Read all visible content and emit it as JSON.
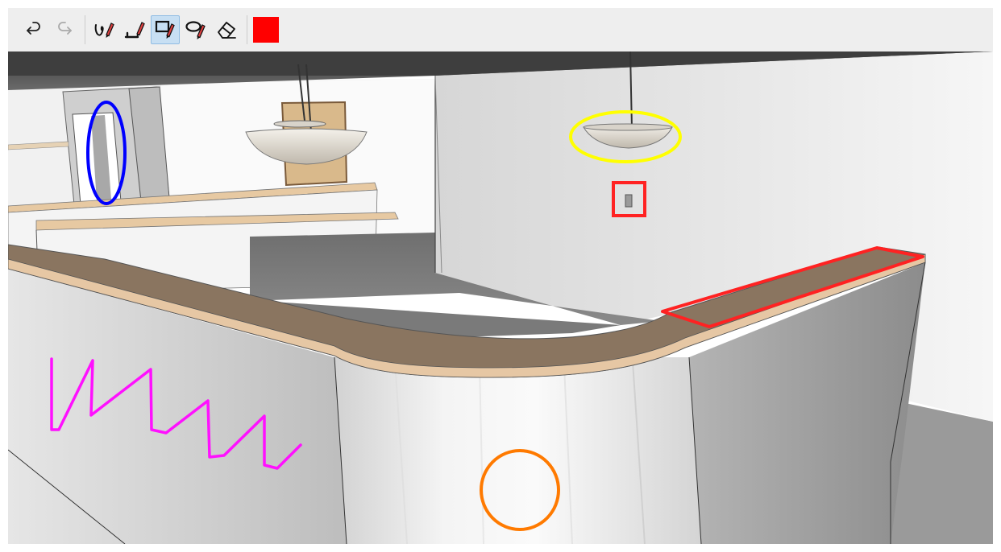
{
  "toolbar": {
    "tools": [
      {
        "id": "undo",
        "icon": "undo-icon",
        "state": "enabled"
      },
      {
        "id": "redo",
        "icon": "redo-icon",
        "state": "disabled"
      },
      {
        "id": "freehand",
        "icon": "freehand-pen-icon",
        "state": "enabled"
      },
      {
        "id": "line",
        "icon": "line-pen-icon",
        "state": "enabled"
      },
      {
        "id": "rectangle",
        "icon": "rectangle-pen-icon",
        "state": "selected"
      },
      {
        "id": "ellipse",
        "icon": "ellipse-pen-icon",
        "state": "enabled"
      },
      {
        "id": "eraser",
        "icon": "eraser-icon",
        "state": "enabled"
      }
    ],
    "current_color": "#ff0000"
  },
  "annotations": [
    {
      "shape": "ellipse",
      "color": "#0000ff"
    },
    {
      "shape": "ellipse",
      "color": "#ffff00"
    },
    {
      "shape": "rectangle",
      "color": "#ff2222"
    },
    {
      "shape": "quadrilateral",
      "color": "#ff2222"
    },
    {
      "shape": "freehand",
      "color": "#ff10ff"
    },
    {
      "shape": "ellipse",
      "color": "#ff7a00"
    }
  ]
}
